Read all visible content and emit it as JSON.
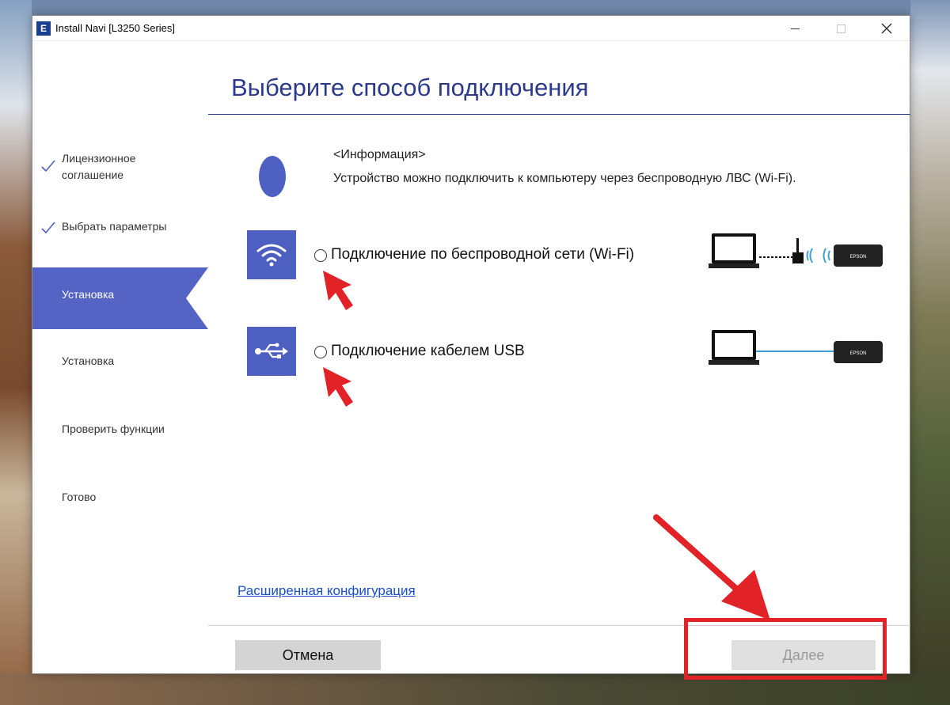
{
  "window": {
    "app_icon_letter": "E",
    "title": "Install Navi [L3250 Series]"
  },
  "sidebar": {
    "items": [
      {
        "label": "Лицензионное соглашение",
        "state": "done"
      },
      {
        "label": "Выбрать параметры",
        "state": "done"
      },
      {
        "label": "Установка",
        "state": "active"
      },
      {
        "label": "Установка",
        "state": "pending"
      },
      {
        "label": "Проверить функции",
        "state": "pending"
      },
      {
        "label": "Готово",
        "state": "pending"
      }
    ]
  },
  "main": {
    "title": "Выберите способ подключения",
    "info_heading": "<Информация>",
    "info_text": "Устройство можно подключить к компьютеру через беспроводную ЛВС (Wi-Fi).",
    "options": [
      {
        "label": "Подключение по беспроводной сети (Wi-Fi)",
        "icon": "wifi-icon",
        "selected": false
      },
      {
        "label": "Подключение кабелем USB",
        "icon": "usb-icon",
        "selected": false
      }
    ],
    "printer_brand": "EPSON",
    "advanced_link": "Расширенная конфигурация",
    "cancel_label": "Отмена",
    "next_label": "Далее"
  },
  "colors": {
    "accent": "#4e5fc2",
    "title": "#2b3a8c",
    "annotation_red": "#e12226",
    "link": "#1a4fc9"
  }
}
